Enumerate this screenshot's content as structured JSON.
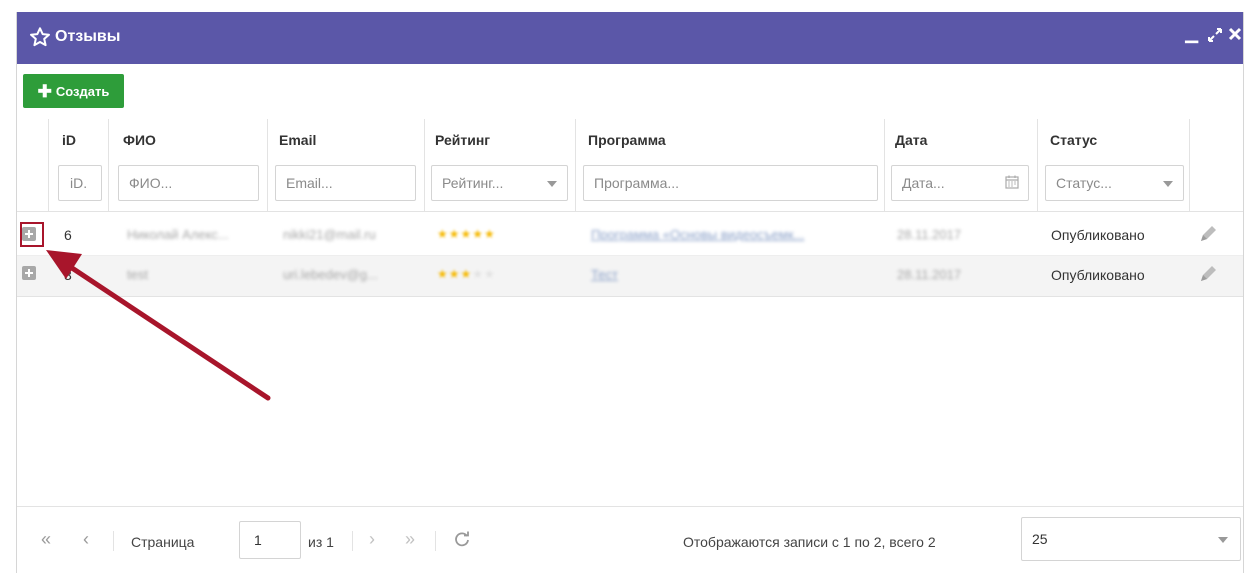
{
  "window": {
    "title": "Отзывы",
    "accent_color": "#5b57a8",
    "icons": [
      "star-outline-icon",
      "minimize-icon",
      "restore-icon",
      "close-icon"
    ]
  },
  "toolbar": {
    "create_label": "Создать",
    "create_color": "#2e9d3a"
  },
  "table": {
    "columns": [
      "iD",
      "ФИО",
      "Email",
      "Рейтинг",
      "Программа",
      "Дата",
      "Статус"
    ],
    "filters": {
      "id": "iD.",
      "fio": "ФИО...",
      "email": "Email...",
      "rating": "Рейтинг...",
      "program": "Программа...",
      "date": "Дата...",
      "status": "Статус..."
    },
    "rows": [
      {
        "id": "6",
        "fio": "Николай Алекс...",
        "email": "nikki21@mail.ru",
        "rating": 5,
        "program": "Программа «Основы видеосъемк...",
        "date": "28.11.2017",
        "status": "Опубликовано"
      },
      {
        "id": "3",
        "fio": "test",
        "email": "uri.lebedev@g...",
        "rating": 3,
        "program": "Тест",
        "date": "28.11.2017",
        "status": "Опубликовано"
      }
    ]
  },
  "pager": {
    "page_label": "Страница",
    "page_value": "1",
    "of_label": "из 1",
    "summary": "Отображаются записи с 1 по 2, всего 2",
    "page_size": "25"
  }
}
